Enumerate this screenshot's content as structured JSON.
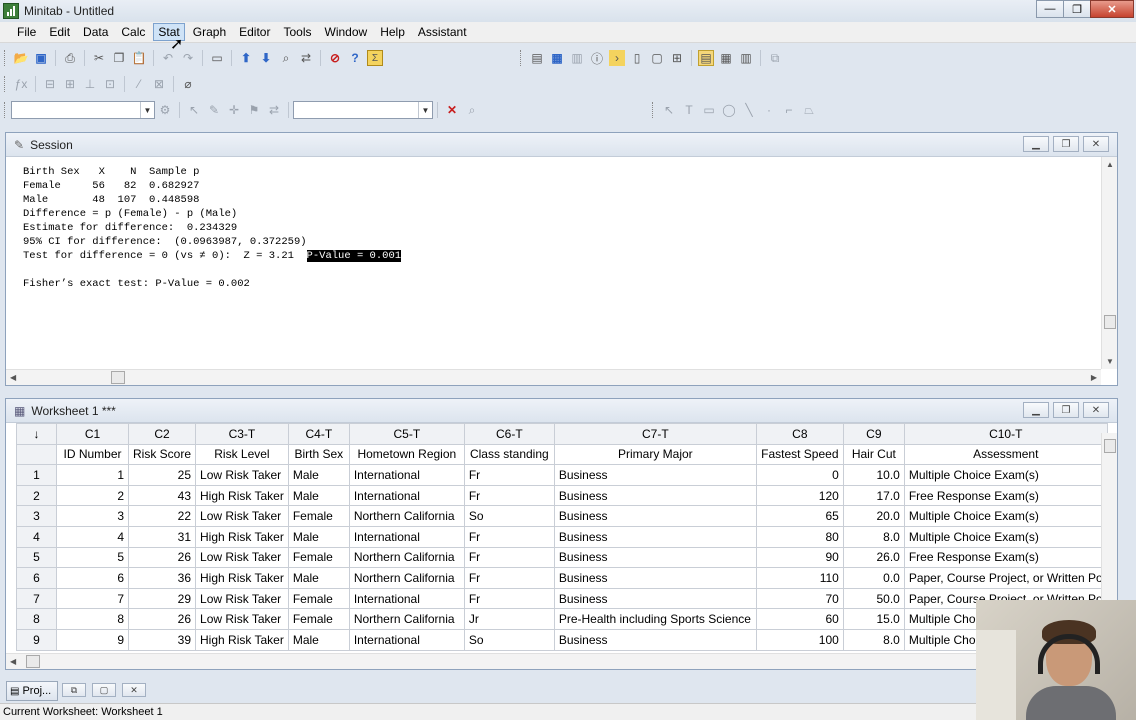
{
  "window": {
    "title": "Minitab - Untitled",
    "controls": {
      "minimize": "—",
      "maximize": "❐",
      "close": "✕"
    }
  },
  "menu": [
    "File",
    "Edit",
    "Data",
    "Calc",
    "Stat",
    "Graph",
    "Editor",
    "Tools",
    "Window",
    "Help",
    "Assistant"
  ],
  "session": {
    "title": "Session",
    "lines": [
      "",
      "",
      "Birth Sex   X    N  Sample p",
      "Female     56   82  0.682927",
      "Male       48  107  0.448598",
      "",
      "",
      "Difference = p (Female) - p (Male)",
      "Estimate for difference:  0.234329",
      "95% CI for difference:  (0.0963987, 0.372259)"
    ],
    "test_line": "Test for difference = 0 (vs ≠ 0):  Z = 3.21  ",
    "pvalue_highlight": "P-Value = 0.001",
    "fisher_line": "Fisher’s exact test: P-Value = 0.002"
  },
  "worksheet": {
    "title": "Worksheet 1 ***",
    "corner": "↓",
    "col_ids": [
      "C1",
      "C2",
      "C3-T",
      "C4-T",
      "C5-T",
      "C6-T",
      "C7-T",
      "C8",
      "C9",
      "C10-T"
    ],
    "col_names": [
      "ID Number",
      "Risk Score",
      "Risk Level",
      "Birth Sex",
      "Hometown Region",
      "Class standing",
      "Primary Major",
      "Fastest Speed",
      "Hair Cut",
      "Assessment"
    ],
    "rows": [
      [
        "1",
        "1",
        "25",
        "Low Risk Taker",
        "Male",
        "International",
        "Fr",
        "Business",
        "0",
        "10.0",
        "Multiple Choice Exam(s)"
      ],
      [
        "2",
        "2",
        "43",
        "High Risk Taker",
        "Male",
        "International",
        "Fr",
        "Business",
        "120",
        "17.0",
        "Free Response Exam(s)"
      ],
      [
        "3",
        "3",
        "22",
        "Low Risk Taker",
        "Female",
        "Northern California",
        "So",
        "Business",
        "65",
        "20.0",
        "Multiple Choice Exam(s)"
      ],
      [
        "4",
        "4",
        "31",
        "High Risk Taker",
        "Male",
        "International",
        "Fr",
        "Business",
        "80",
        "8.0",
        "Multiple Choice Exam(s)"
      ],
      [
        "5",
        "5",
        "26",
        "Low Risk Taker",
        "Female",
        "Northern California",
        "Fr",
        "Business",
        "90",
        "26.0",
        "Free Response Exam(s)"
      ],
      [
        "6",
        "6",
        "36",
        "High Risk Taker",
        "Male",
        "Northern California",
        "Fr",
        "Business",
        "110",
        "0.0",
        "Paper, Course Project, or Written Po"
      ],
      [
        "7",
        "7",
        "29",
        "Low Risk Taker",
        "Female",
        "International",
        "Fr",
        "Business",
        "70",
        "50.0",
        "Paper, Course Project, or Written Po"
      ],
      [
        "8",
        "8",
        "26",
        "Low Risk Taker",
        "Female",
        "Northern California",
        "Jr",
        "Pre-Health including Sports Science",
        "60",
        "15.0",
        "Multiple Choic"
      ],
      [
        "9",
        "9",
        "39",
        "High Risk Taker",
        "Male",
        "International",
        "So",
        "Business",
        "100",
        "8.0",
        "Multiple Choic"
      ]
    ]
  },
  "project": {
    "label": "Proj..."
  },
  "status": {
    "text": "Current Worksheet: Worksheet 1"
  }
}
